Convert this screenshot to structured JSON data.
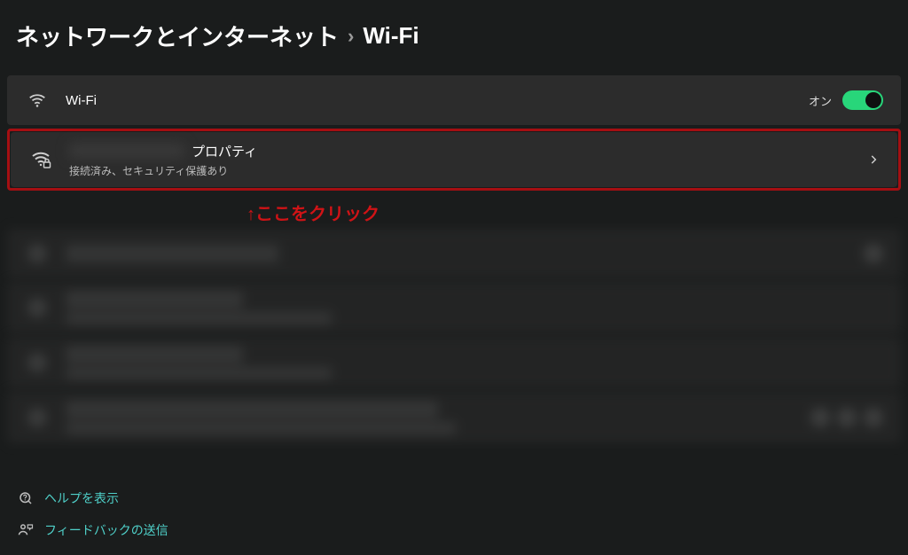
{
  "breadcrumb": {
    "parent": "ネットワークとインターネット",
    "current": "Wi-Fi"
  },
  "wifi_toggle": {
    "label": "Wi-Fi",
    "state_label": "オン",
    "on": true
  },
  "connected": {
    "properties_suffix": "プロパティ",
    "status": "接続済み、セキュリティ保護あり"
  },
  "annotation": "↑ここをクリック",
  "footer": {
    "help": "ヘルプを表示",
    "feedback": "フィードバックの送信"
  }
}
